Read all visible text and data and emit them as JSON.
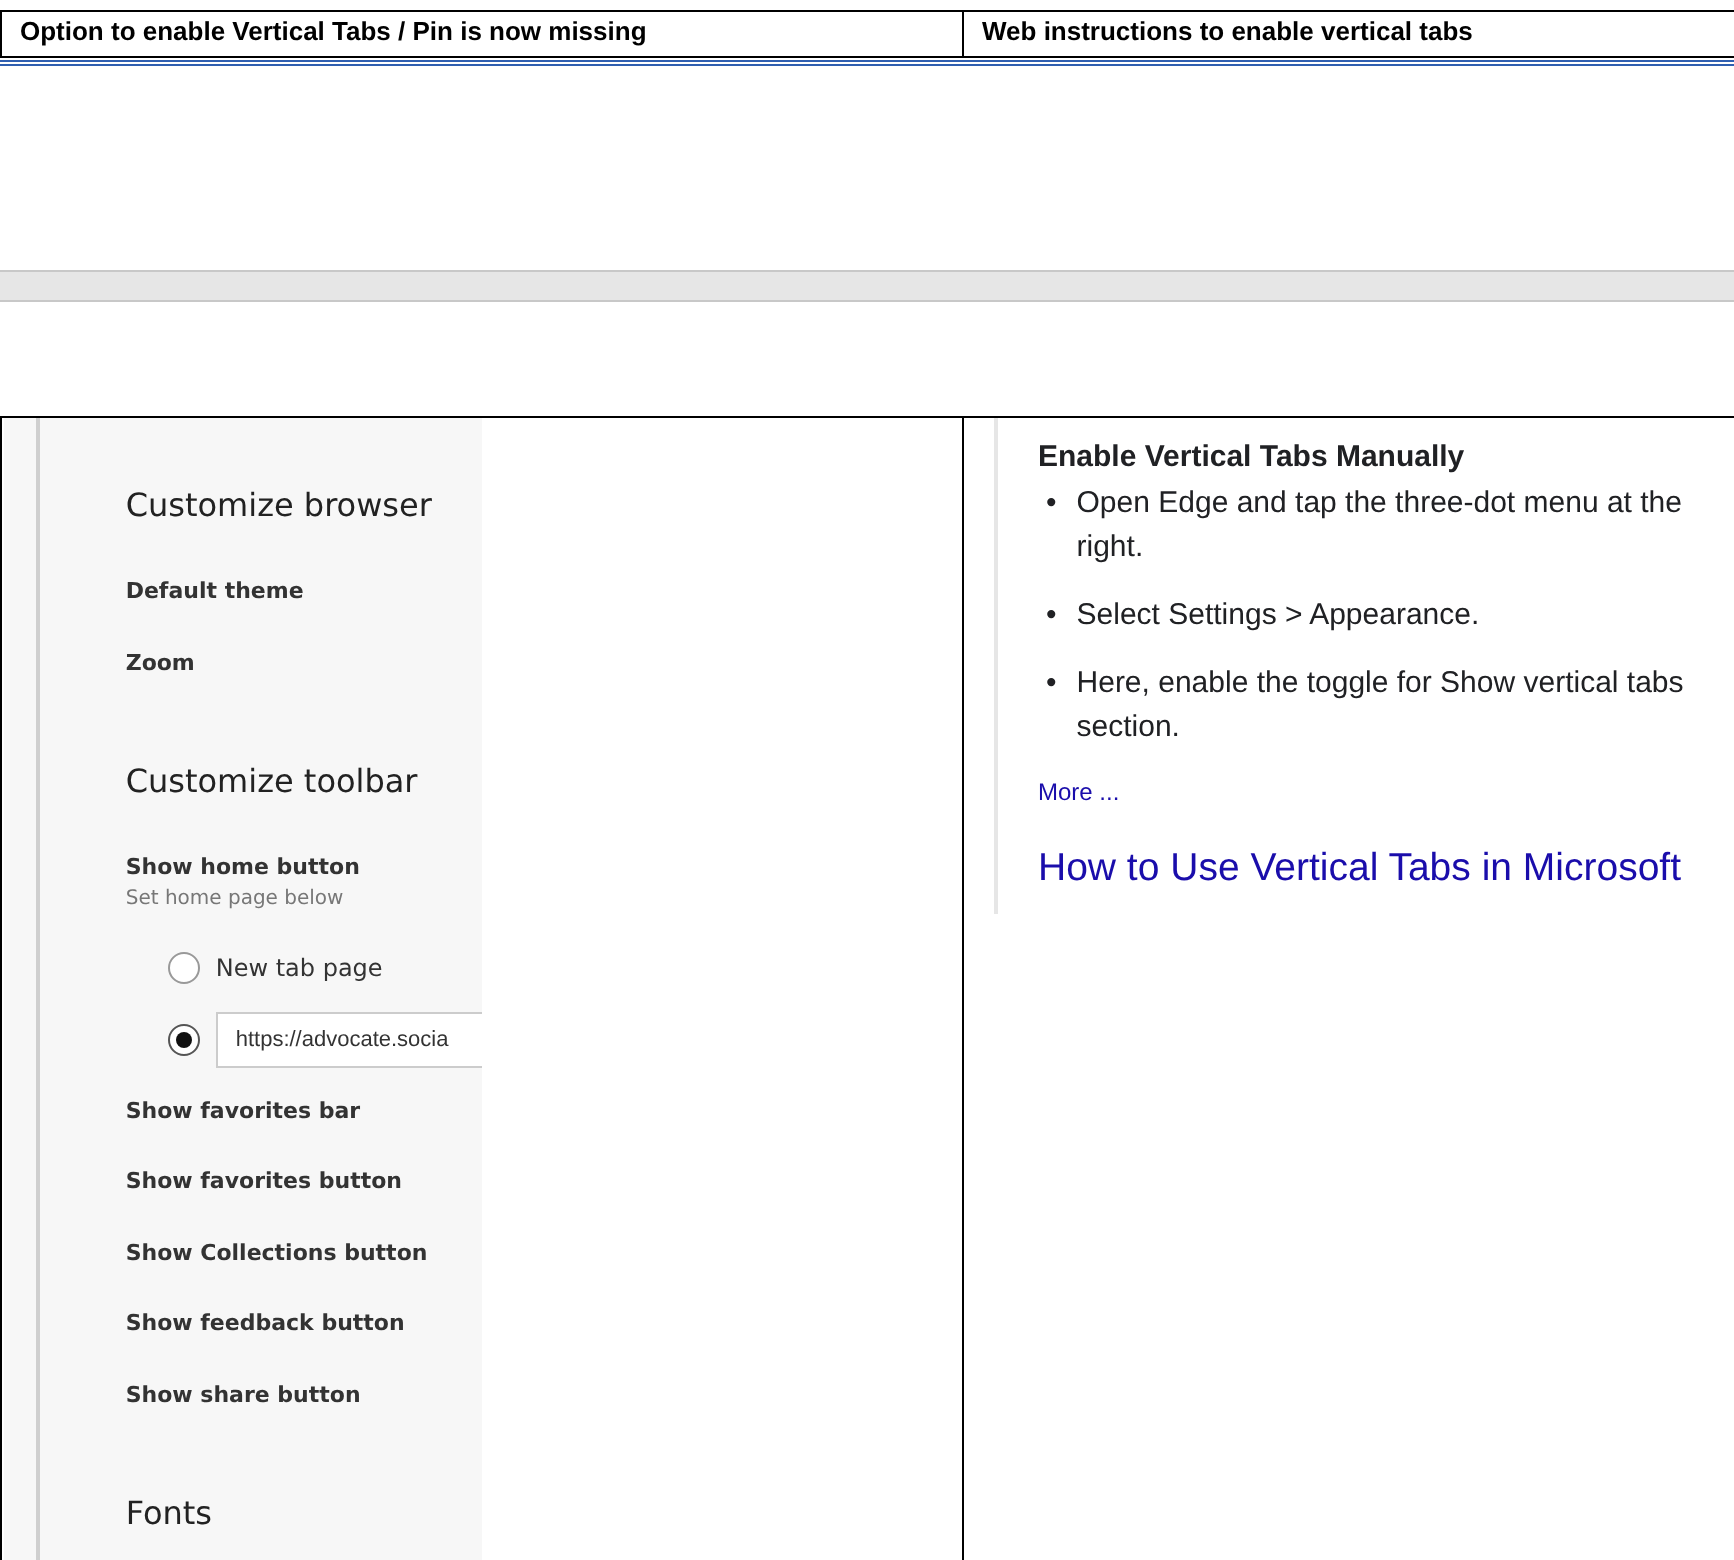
{
  "header_row": [
    "Option to enable Vertical Tabs / Pin is now missing",
    "Web instructions to enable vertical tabs"
  ],
  "settings": [
    {
      "kind": "heading",
      "text": "Customize browser"
    },
    {
      "kind": "setting",
      "text": "Default theme"
    },
    {
      "kind": "setting",
      "text": "Zoom"
    },
    {
      "kind": "heading",
      "text": "Customize toolbar"
    },
    {
      "kind": "setting",
      "text": "Show home button"
    },
    {
      "kind": "hint",
      "text": "Set home page below"
    },
    {
      "kind": "radio",
      "text": "New tab page",
      "selected": false
    },
    {
      "kind": "radio",
      "value": "https://advocate.socia",
      "selected": true
    },
    {
      "kind": "setting",
      "text": "Show favorites bar"
    },
    {
      "kind": "setting",
      "text": "Show favorites button"
    },
    {
      "kind": "setting",
      "text": "Show Collections button"
    },
    {
      "kind": "setting",
      "text": "Show feedback button"
    },
    {
      "kind": "setting",
      "text": "Show share button"
    },
    {
      "kind": "heading",
      "text": "Fonts"
    }
  ],
  "snippet": {
    "heading": "Enable Vertical Tabs Manually",
    "bullet_marker": "•",
    "bullets": [
      [
        "Open Edge and tap the three-dot menu at the",
        "right."
      ],
      [
        "Select Settings > Appearance."
      ],
      [
        "Here, enable the toggle for Show vertical tabs",
        "section."
      ]
    ],
    "more": "More ...",
    "result_title": "How to Use Vertical Tabs in Microsoft"
  }
}
